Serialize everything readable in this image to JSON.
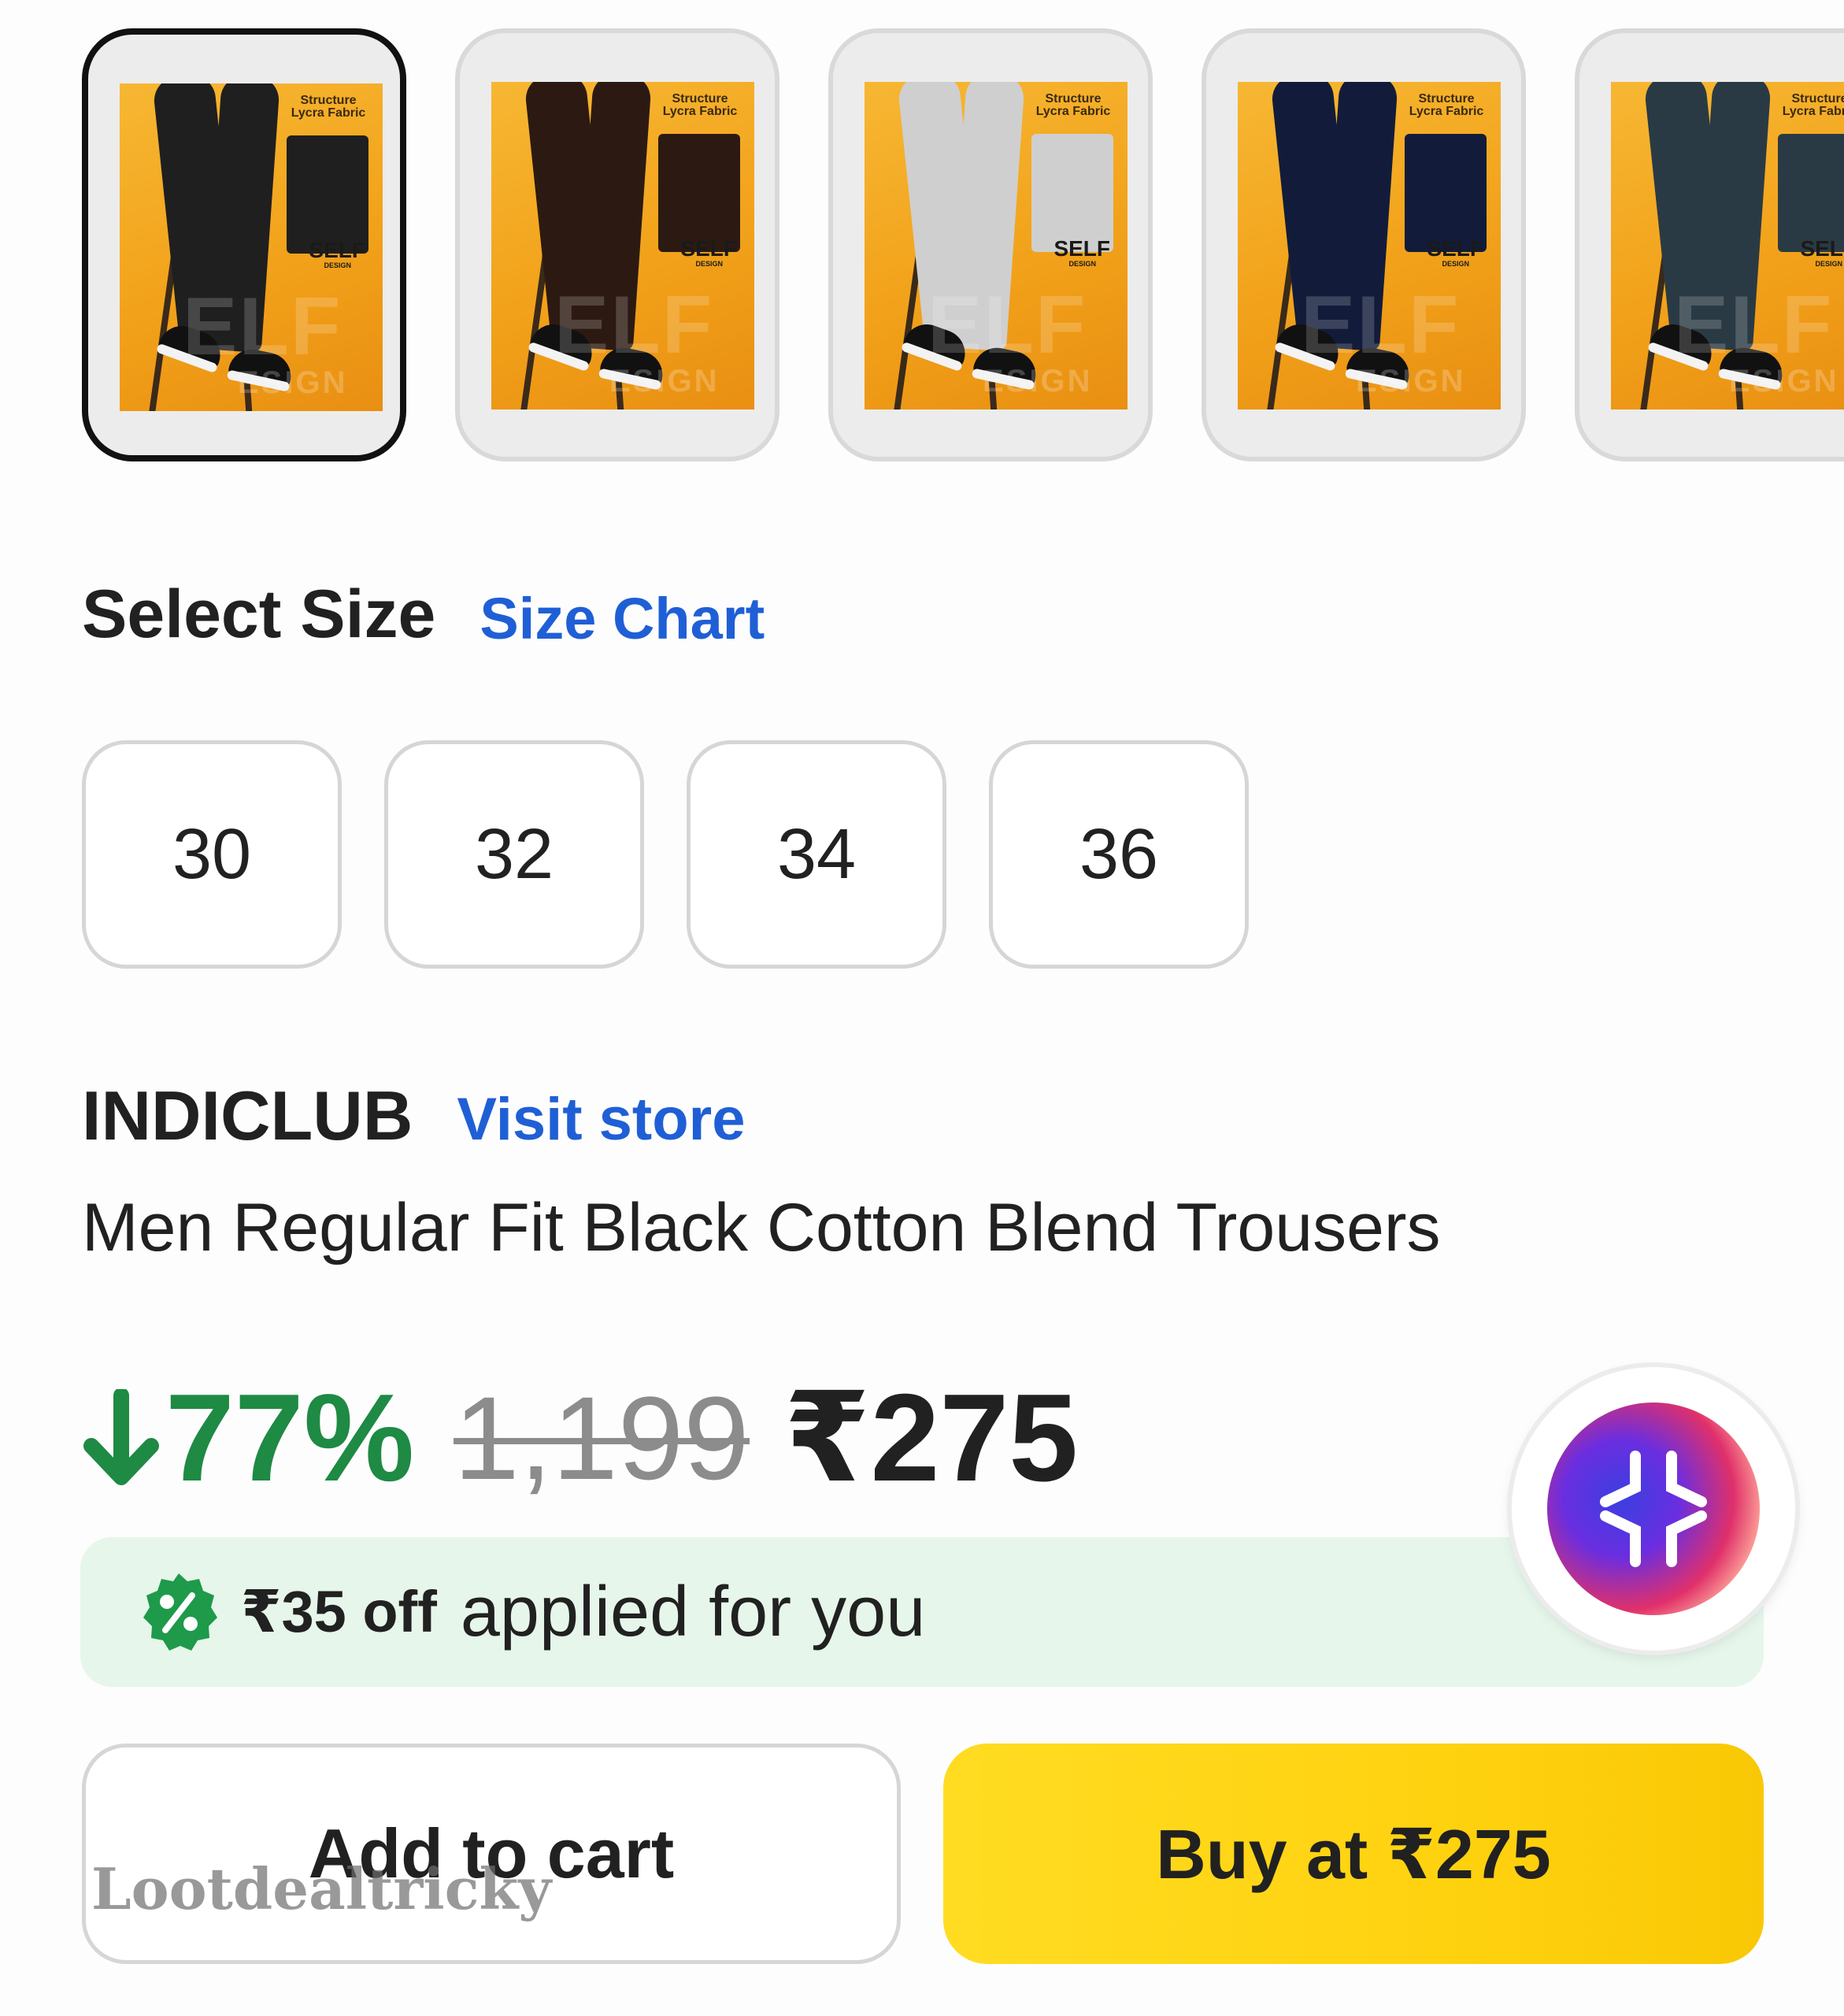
{
  "gallery": {
    "thumbnails": [
      {
        "color_name": "black",
        "pant_color": "#1f1f1f",
        "selected": true,
        "text_top": "Structure Lycra Fabric",
        "text_brand": "SELF",
        "text_design": "DESIGN"
      },
      {
        "color_name": "brown",
        "pant_color": "#2c1a12",
        "selected": false,
        "text_top": "Structure Lycra Fabric",
        "text_brand": "SELF",
        "text_design": "DESIGN"
      },
      {
        "color_name": "light-grey",
        "pant_color": "#cfcfcf",
        "selected": false,
        "text_top": "Structure Lycra Fabric",
        "text_brand": "SELF",
        "text_design": "DESIGN"
      },
      {
        "color_name": "navy",
        "pant_color": "#121c3a",
        "selected": false,
        "text_top": "Structure Lycra Fabric",
        "text_brand": "SELF",
        "text_design": "DESIGN"
      },
      {
        "color_name": "slate",
        "pant_color": "#2a3a44",
        "selected": false,
        "text_top": "Structure Lycra Fabric",
        "text_brand": "SELF",
        "text_design": "DESIGN"
      }
    ]
  },
  "size": {
    "title": "Select Size",
    "chart_link": "Size Chart",
    "options": [
      "30",
      "32",
      "34",
      "36"
    ]
  },
  "product": {
    "brand": "INDICLUB",
    "visit_store": "Visit store",
    "title": "Men Regular Fit Black Cotton Blend Trousers"
  },
  "price": {
    "discount": "77%",
    "mrp": "1,199",
    "final": "₹275"
  },
  "offer": {
    "amount": "₹35 off",
    "text": "applied for you"
  },
  "actions": {
    "add_to_cart": "Add to cart",
    "buy": "Buy at ₹275"
  },
  "watermark": "Lootdealtricky",
  "colors": {
    "link_blue": "#1f5fd6",
    "discount_green": "#1e8a44",
    "offer_bg": "#e6f6ea",
    "buy_yellow": "#ffd210"
  },
  "icons": {
    "discount_arrow": "arrow-down-icon",
    "offer_badge": "percent-badge-icon",
    "assistant": "assistant-sparkle-icon"
  }
}
